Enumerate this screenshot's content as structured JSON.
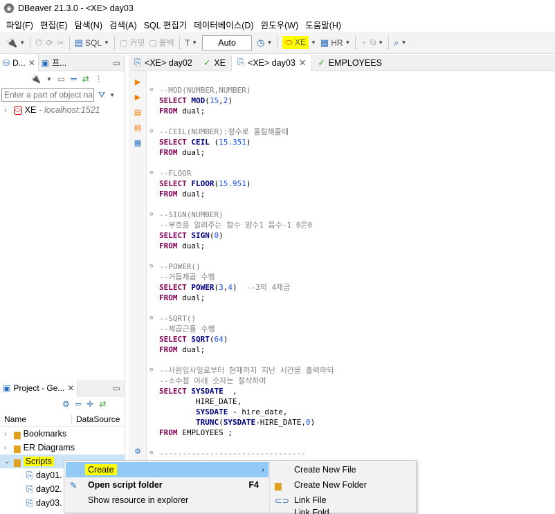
{
  "window": {
    "title": "DBeaver 21.3.0 - <XE> day03"
  },
  "menu": [
    "파일(F)",
    "편집(E)",
    "탐색(N)",
    "검색(A)",
    "SQL 편집기",
    "데이터베이스(D)",
    "윈도우(W)",
    "도움말(H)"
  ],
  "toolbar": {
    "sql_label": "SQL",
    "commit_label": "커밋",
    "rollback_label": "롤백",
    "transaction_mode": "Auto",
    "datasource_label": "XE",
    "schema_label": "HR"
  },
  "navigator": {
    "tabs": [
      "D...",
      "프..."
    ],
    "filter_placeholder": "Enter a part of object na",
    "connection": {
      "name": "XE",
      "host": "- localhost:1521"
    }
  },
  "editor": {
    "tabs": [
      "<XE> day02",
      "XE",
      "<XE> day03",
      "EMPLOYEES"
    ],
    "active_tab": "<XE> day03"
  },
  "project": {
    "tab_label": "Project - Ge...",
    "columns": [
      "Name",
      "DataSource"
    ],
    "items": [
      "Bookmarks",
      "ER Diagrams",
      "Scripts"
    ],
    "scripts": [
      "day01.",
      "day02.",
      "day03."
    ]
  },
  "context_menu": {
    "items": [
      {
        "label": "Create",
        "shortcut": ""
      },
      {
        "label": "Open script folder",
        "shortcut": "F4"
      },
      {
        "label": "Show resource in explorer",
        "shortcut": ""
      }
    ],
    "submenu": [
      "Create New File",
      "Create New Folder",
      "Link File",
      "Link Fold"
    ]
  },
  "colors": {
    "highlight": "#ffff00",
    "menu_selected": "#91c9f7",
    "keyword": "#7f0055",
    "comment": "#808080"
  }
}
